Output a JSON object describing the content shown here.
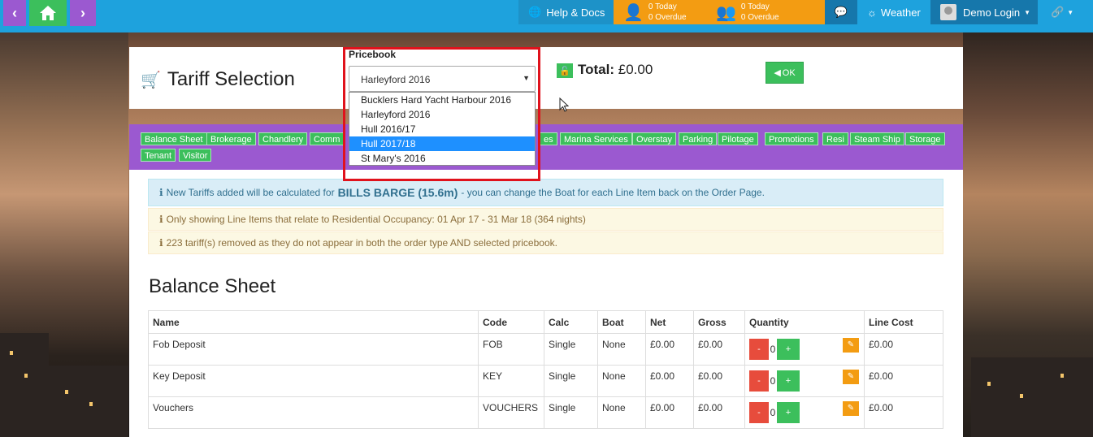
{
  "nav": {
    "help_label": "Help & Docs",
    "tasks_today_1": "0 Today",
    "tasks_overdue_1": "0 Overdue",
    "tasks_today_2": "0 Today",
    "tasks_overdue_2": "0 Overdue",
    "weather_label": "Weather",
    "user_label": "Demo Login"
  },
  "header": {
    "title": "Tariff Selection",
    "pricebook_label": "Pricebook",
    "pricebook_selected": "Harleyford 2016",
    "total_label": "Total:",
    "total_value": "£0.00",
    "ok_label": "OK"
  },
  "dropdown": {
    "options": [
      "Bucklers Hard Yacht Harbour 2016",
      "Harleyford 2016",
      "Hull 2016/17",
      "Hull 2017/18",
      "St Mary's 2016"
    ],
    "highlighted": "Hull 2017/18"
  },
  "tags": {
    "balance_sheet": "Balance Sheet",
    "brokerage": "Brokerage",
    "chandlery": "Chandlery",
    "comm": "Comm",
    "es": "es",
    "marina_services": "Marina Services",
    "overstay": "Overstay",
    "parking": "Parking",
    "pilotage": "Pilotage",
    "promotions": "Promotions",
    "resi": "Resi",
    "steam_ship": "Steam Ship",
    "storage": "Storage",
    "tenant": "Tenant",
    "visitor": "Visitor"
  },
  "alerts": {
    "info_pre": "New Tariffs added will be calculated for",
    "info_boat": "BILLS BARGE (15.6m)",
    "info_post": "- you can change the Boat for each Line Item back on the Order Page.",
    "warn1": "Only showing Line Items that relate to Residential Occupancy: 01 Apr 17 - 31 Mar 18 (364 nights)",
    "warn2": "223 tariff(s) removed as they do not appear in both the order type AND selected pricebook."
  },
  "section": {
    "title": "Balance Sheet"
  },
  "table": {
    "headers": {
      "name": "Name",
      "code": "Code",
      "calc": "Calc",
      "boat": "Boat",
      "net": "Net",
      "gross": "Gross",
      "quantity": "Quantity",
      "line_cost": "Line Cost"
    },
    "rows": [
      {
        "name": "Fob Deposit",
        "code": "FOB",
        "calc": "Single",
        "boat": "None",
        "net": "£0.00",
        "gross": "£0.00",
        "qty": "0",
        "line_cost": "£0.00"
      },
      {
        "name": "Key Deposit",
        "code": "KEY",
        "calc": "Single",
        "boat": "None",
        "net": "£0.00",
        "gross": "£0.00",
        "qty": "0",
        "line_cost": "£0.00"
      },
      {
        "name": "Vouchers",
        "code": "VOUCHERS",
        "calc": "Single",
        "boat": "None",
        "net": "£0.00",
        "gross": "£0.00",
        "qty": "0",
        "line_cost": "£0.00"
      }
    ],
    "minus_label": "-",
    "plus_label": "+"
  }
}
